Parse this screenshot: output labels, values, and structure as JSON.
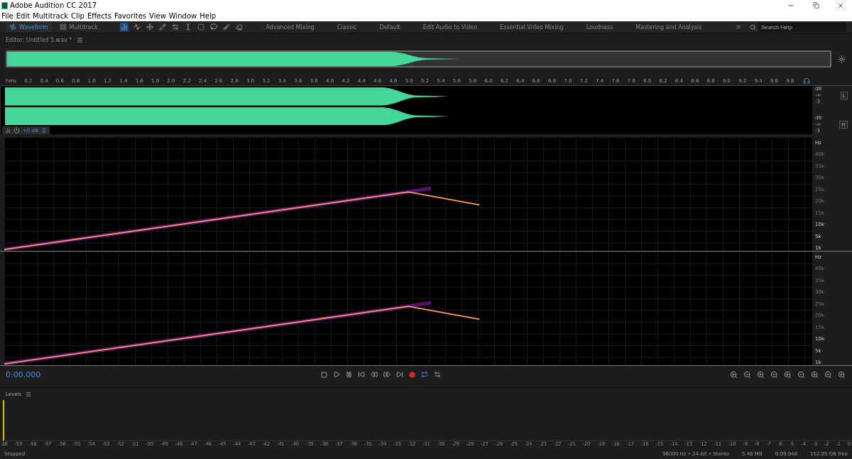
{
  "window": {
    "title": "Adobe Audition CC 2017"
  },
  "menu": [
    "File",
    "Edit",
    "Multitrack",
    "Clip",
    "Effects",
    "Favorites",
    "View",
    "Window",
    "Help"
  ],
  "view_tabs": [
    {
      "label": "Waveform",
      "selected": true
    },
    {
      "label": "Multitrack",
      "selected": false
    }
  ],
  "workspaces": [
    "Advanced Mixing",
    "Classic",
    "Default",
    "Edit Audio to Video",
    "Essential Video Mixing",
    "Loudness",
    "Mastering and Analysis"
  ],
  "search": {
    "placeholder": "Search Help"
  },
  "editor": {
    "title": "Editor: Untitled 5.wav *"
  },
  "ruler": [
    "hms",
    "0.2",
    "0.4",
    "0.6",
    "0.8",
    "1.0",
    "1.2",
    "1.4",
    "1.6",
    "1.8",
    "2.0",
    "2.2",
    "2.4",
    "2.6",
    "2.8",
    "3.0",
    "3.2",
    "3.4",
    "3.6",
    "3.8",
    "4.0",
    "4.2",
    "4.4",
    "4.6",
    "4.8",
    "5.0",
    "5.2",
    "5.4",
    "5.6",
    "5.8",
    "6.0",
    "6.2",
    "6.4",
    "6.6",
    "6.8",
    "7.0",
    "7.2",
    "7.4",
    "7.6",
    "7.8",
    "8.0",
    "8.2",
    "8.4",
    "8.6",
    "8.8",
    "9.0",
    "9.2",
    "9.4",
    "9.6",
    "9.8"
  ],
  "channels": [
    {
      "label": "L",
      "db_labels": [
        "dB",
        "-∞",
        "-3"
      ]
    },
    {
      "label": "R",
      "db_labels": [
        "dB",
        "-∞",
        "-3"
      ]
    }
  ],
  "gain_hud": "+0 dB",
  "spectral_channels": [
    {
      "unit": "Hz",
      "ticks": [
        "40k",
        "35k",
        "30k",
        "25k",
        "20k",
        "15k",
        "10k",
        "5k",
        "1k"
      ]
    },
    {
      "unit": "Hz",
      "ticks": [
        "40k",
        "35k",
        "30k",
        "25k",
        "20k",
        "15k",
        "10k",
        "5k",
        "1k"
      ]
    }
  ],
  "transport": {
    "time": "0:00.000",
    "record_armed": true,
    "loop": true
  },
  "levels": {
    "title": "Levels",
    "scale": [
      "dB",
      "-59",
      "-58",
      "-57",
      "-56",
      "-55",
      "-54",
      "-53",
      "-52",
      "-51",
      "-50",
      "-49",
      "-48",
      "-47",
      "-46",
      "-45",
      "-44",
      "-43",
      "-42",
      "-41",
      "-40",
      "-39",
      "-38",
      "-37",
      "-36",
      "-35",
      "-34",
      "-33",
      "-32",
      "-31",
      "-30",
      "-29",
      "-28",
      "-27",
      "-26",
      "-25",
      "-24",
      "-23",
      "-22",
      "-21",
      "-20",
      "-19",
      "-18",
      "-17",
      "-16",
      "-15",
      "-14",
      "-13",
      "-12",
      "-11",
      "-10",
      "-9",
      "-8",
      "-7",
      "-6",
      "-5",
      "-4",
      "-3",
      "-2",
      "-1",
      "0"
    ]
  },
  "status_bar": {
    "state": "Stopped",
    "format": "96000 Hz • 24-bit • Stereo",
    "size": "5.46 MB",
    "duration": "0:09.948",
    "free": "152.05 GB free"
  }
}
